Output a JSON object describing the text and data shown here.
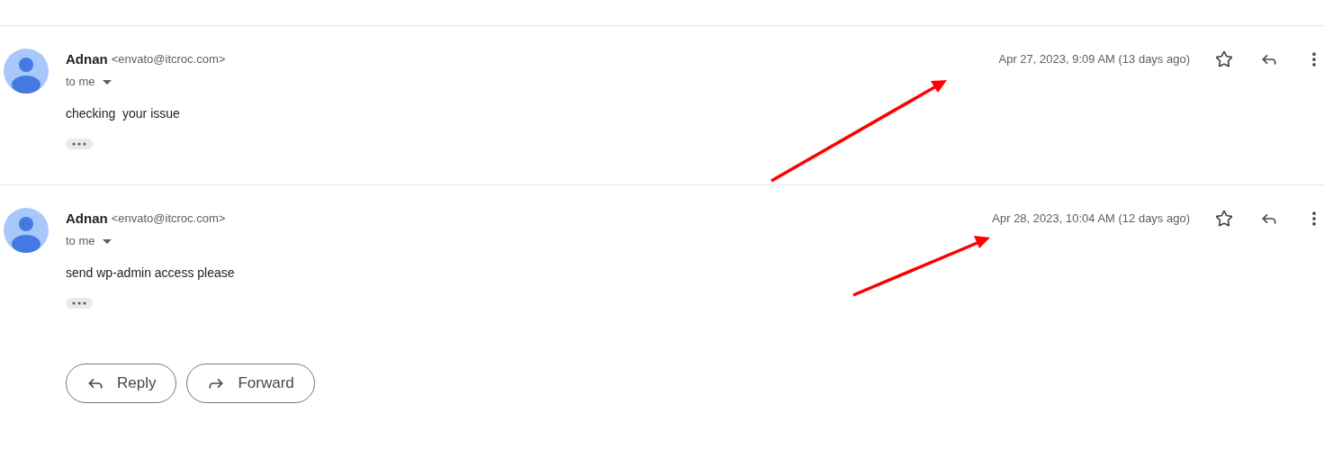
{
  "messages": [
    {
      "sender": "Adnan",
      "email": "<envato@itcroc.com>",
      "recipient": "to me",
      "date": "Apr 27, 2023, 9:09 AM (13 days ago)",
      "starred": false,
      "body": "checking  your issue"
    },
    {
      "sender": "Adnan",
      "email": "<envato@itcroc.com>",
      "recipient": "to me",
      "date": "Apr 28, 2023, 10:04 AM (12 days ago)",
      "starred": false,
      "body": "send wp-admin access please"
    }
  ],
  "actions": [
    {
      "kind": "reply",
      "label": "Reply"
    },
    {
      "kind": "forward",
      "label": "Forward"
    }
  ]
}
